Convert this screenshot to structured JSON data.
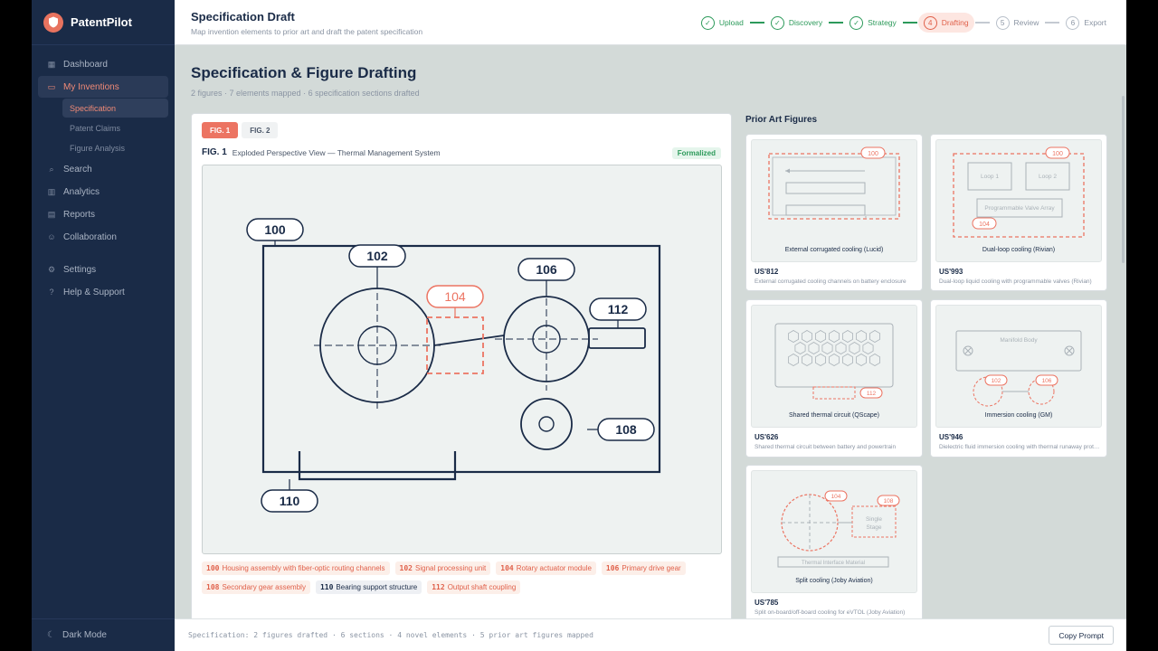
{
  "brand": {
    "name": "PatentPilot"
  },
  "sidebar": {
    "items": [
      {
        "label": "Dashboard",
        "icon": "grid-icon"
      },
      {
        "label": "My Inventions",
        "icon": "folder-icon"
      },
      {
        "label": "Search",
        "icon": "search-icon"
      },
      {
        "label": "Analytics",
        "icon": "chart-icon"
      },
      {
        "label": "Reports",
        "icon": "document-icon"
      },
      {
        "label": "Collaboration",
        "icon": "users-icon"
      },
      {
        "label": "Settings",
        "icon": "gear-icon"
      },
      {
        "label": "Help & Support",
        "icon": "help-icon"
      }
    ],
    "subitems": [
      {
        "label": "Specification"
      },
      {
        "label": "Patent Claims"
      },
      {
        "label": "Figure Analysis"
      }
    ],
    "dark_mode_label": "Dark Mode"
  },
  "header": {
    "title": "Specification Draft",
    "subtitle": "Map invention elements to prior art and draft the patent specification"
  },
  "stepper": [
    {
      "num": "1",
      "label": "Upload",
      "state": "done"
    },
    {
      "num": "2",
      "label": "Discovery",
      "state": "done"
    },
    {
      "num": "3",
      "label": "Strategy",
      "state": "done"
    },
    {
      "num": "4",
      "label": "Drafting",
      "state": "current"
    },
    {
      "num": "5",
      "label": "Review",
      "state": "todo"
    },
    {
      "num": "6",
      "label": "Export",
      "state": "todo"
    }
  ],
  "page": {
    "title": "Specification & Figure Drafting",
    "subtitle": "2 figures · 7 elements mapped · 6 specification sections drafted"
  },
  "figure": {
    "tabs": [
      "FIG. 1",
      "FIG. 2"
    ],
    "label": "FIG. 1",
    "caption": "Exploded Perspective View — Thermal Management System",
    "status": "Formalized",
    "refs": [
      "100",
      "102",
      "104",
      "106",
      "108",
      "110",
      "112"
    ]
  },
  "legend": [
    {
      "num": "100",
      "text": "Housing assembly with fiber-optic routing channels",
      "style": "novel"
    },
    {
      "num": "102",
      "text": "Signal processing unit",
      "style": "novel"
    },
    {
      "num": "104",
      "text": "Rotary actuator module",
      "style": "novel"
    },
    {
      "num": "106",
      "text": "Primary drive gear",
      "style": "novel"
    },
    {
      "num": "108",
      "text": "Secondary gear assembly",
      "style": "novel"
    },
    {
      "num": "110",
      "text": "Bearing support structure",
      "style": "known"
    },
    {
      "num": "112",
      "text": "Output shaft coupling",
      "style": "novel"
    }
  ],
  "prior_art": {
    "title": "Prior Art Figures",
    "cards": [
      {
        "id": "US'812",
        "caption": "External corrugated cooling (Lucid)",
        "desc": "External corrugated cooling channels on battery enclosure",
        "tags": [
          "100"
        ]
      },
      {
        "id": "US'993",
        "caption": "Dual-loop cooling (Rivian)",
        "desc": "Dual-loop liquid cooling with programmable valves (Rivian)",
        "tags": [
          "100",
          "104"
        ],
        "boxes": [
          "Loop 1",
          "Loop 2",
          "Programmable Valve Array"
        ]
      },
      {
        "id": "US'626",
        "caption": "Shared thermal circuit (QScape)",
        "desc": "Shared thermal circuit between battery and powertrain",
        "tags": [
          "112"
        ]
      },
      {
        "id": "US'946",
        "caption": "Immersion cooling (GM)",
        "desc": "Dielectric fluid immersion cooling with thermal runaway protection",
        "tags": [
          "102",
          "106"
        ],
        "boxes": [
          "Manifold Body"
        ]
      },
      {
        "id": "US'785",
        "caption": "Split cooling (Joby Aviation)",
        "desc": "Split on-board/off-board cooling for eVTOL (Joby Aviation)",
        "tags": [
          "104",
          "108"
        ],
        "boxes": [
          "Single",
          "Stage",
          "Thermal Interface Material"
        ]
      }
    ]
  },
  "footer": {
    "text": "Specification: 2 figures drafted · 6 sections · 4 novel elements · 5 prior art figures mapped",
    "button": "Copy Prompt"
  },
  "colors": {
    "accent": "#ec7462",
    "sidebar": "#1a2b47",
    "success": "#2c9a5a"
  }
}
